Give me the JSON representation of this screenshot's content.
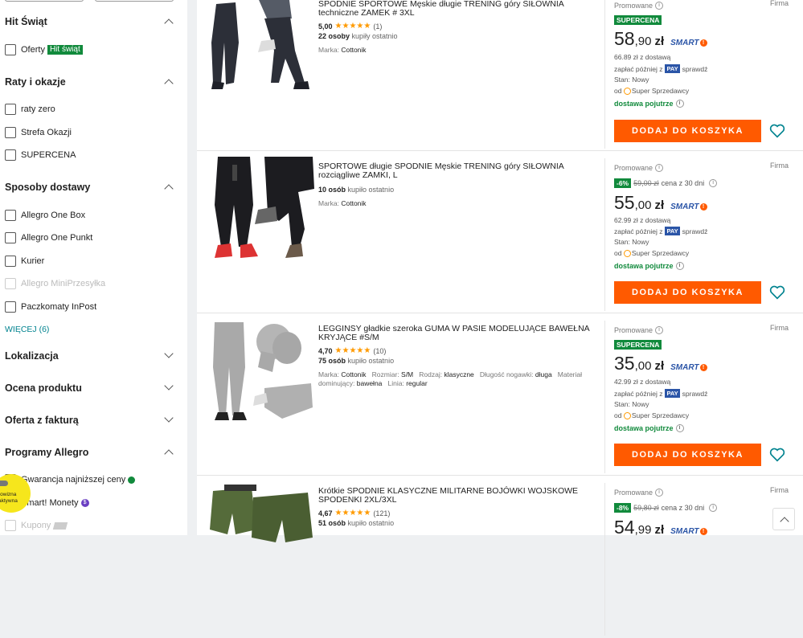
{
  "filters": {
    "hit_swiat": {
      "title": "Hit Świąt",
      "options": [
        {
          "label": "Oferty",
          "badge": "Hit świąt"
        }
      ]
    },
    "raty": {
      "title": "Raty i okazje",
      "options": [
        "raty zero",
        "Strefa Okazji",
        "SUPERCENA"
      ]
    },
    "dostawa": {
      "title": "Sposoby dostawy",
      "options": [
        "Allegro One Box",
        "Allegro One Punkt",
        "Kurier",
        "Allegro MiniPrzesyłka",
        "Paczkomaty InPost"
      ],
      "disabled": "Allegro MiniPrzesyłka",
      "more": "WIĘCEJ (6)"
    },
    "lokalizacja": {
      "title": "Lokalizacja"
    },
    "ocena": {
      "title": "Ocena produktu"
    },
    "faktura": {
      "title": "Oferta z fakturą"
    },
    "programy": {
      "title": "Programy Allegro",
      "options": [
        "Gwarancja najniższej ceny",
        "Smart! Monety",
        "Kupony"
      ]
    },
    "promo_bubble": {
      "line1": "rowizna",
      "line2": "aktywna"
    }
  },
  "products": [
    {
      "title": "SPODNIE SPORTOWE Męskie długie TRENING góry SIŁOWNIA techniczne ZAMEK # 3XL",
      "rating": "5,00",
      "stars": "★★★★★",
      "reviews": "(1)",
      "bought_count": "22 osoby",
      "bought_text": "kupiły ostatnio",
      "attrs": [
        {
          "k": "Marka:",
          "v": "Cottonik"
        }
      ],
      "promo": "Promowane",
      "seller_type": "Firma",
      "badge": "SUPERCENA",
      "price_int": "58",
      "price_dec": ",90",
      "currency": "zł",
      "with_delivery": "66.89 zł z dostawą",
      "pay_later": "zapłać później z",
      "pay": "PAY",
      "check": "sprawdź",
      "condition": "Stan: Nowy",
      "seller_prefix": "od",
      "seller": "Super Sprzedawcy",
      "delivery": "dostawa pojutrze",
      "cart": "DODAJ DO KOSZYKA"
    },
    {
      "title": "SPORTOWE długie SPODNIE Męskie TRENING góry SIŁOWNIA rozciągliwe ZAMKI, L",
      "rating": "",
      "stars": "",
      "reviews": "",
      "bought_count": "10 osób",
      "bought_text": "kupiło ostatnio",
      "attrs": [
        {
          "k": "Marka:",
          "v": "Cottonik"
        }
      ],
      "promo": "Promowane",
      "seller_type": "Firma",
      "discount": "-6%",
      "old_price": "59,00 zł",
      "old_price_note": "cena z 30 dni",
      "price_int": "55",
      "price_dec": ",00",
      "currency": "zł",
      "with_delivery": "62.99 zł z dostawą",
      "pay_later": "zapłać później z",
      "pay": "PAY",
      "check": "sprawdź",
      "condition": "Stan: Nowy",
      "seller_prefix": "od",
      "seller": "Super Sprzedawcy",
      "delivery": "dostawa pojutrze",
      "cart": "DODAJ DO KOSZYKA"
    },
    {
      "title": "LEGGINSY gładkie szeroka GUMA W PASIE MODELUJĄCE BAWEŁNA KRYJĄCE #S/M",
      "rating": "4,70",
      "stars": "★★★★★",
      "reviews": "(10)",
      "bought_count": "75 osób",
      "bought_text": "kupiło ostatnio",
      "attrs": [
        {
          "k": "Marka:",
          "v": "Cottonik"
        },
        {
          "k": "Rozmiar:",
          "v": "S/M"
        },
        {
          "k": "Rodzaj:",
          "v": "klasyczne"
        },
        {
          "k": "Długość nogawki:",
          "v": "długa"
        },
        {
          "k": "Materiał dominujący:",
          "v": "bawełna"
        },
        {
          "k": "Linia:",
          "v": "regular"
        }
      ],
      "promo": "Promowane",
      "seller_type": "Firma",
      "badge": "SUPERCENA",
      "price_int": "35",
      "price_dec": ",00",
      "currency": "zł",
      "with_delivery": "42.99 zł z dostawą",
      "pay_later": "zapłać później z",
      "pay": "PAY",
      "check": "sprawdź",
      "condition": "Stan: Nowy",
      "seller_prefix": "od",
      "seller": "Super Sprzedawcy",
      "delivery": "dostawa pojutrze",
      "cart": "DODAJ DO KOSZYKA"
    },
    {
      "title": "Krótkie SPODNIE KLASYCZNE MILITARNE BOJÓWKI WOJSKOWE SPODENKI 2XL/3XL",
      "rating": "4,67",
      "stars": "★★★★★",
      "reviews": "(121)",
      "bought_count": "51 osób",
      "bought_text": "kupiło ostatnio",
      "attrs": [],
      "promo": "Promowane",
      "seller_type": "Firma",
      "discount": "-8%",
      "old_price": "59,80 zł",
      "old_price_note": "cena z 30 dni",
      "price_int": "54",
      "price_dec": ",99",
      "currency": "zł"
    }
  ],
  "smart_label": "SMART"
}
